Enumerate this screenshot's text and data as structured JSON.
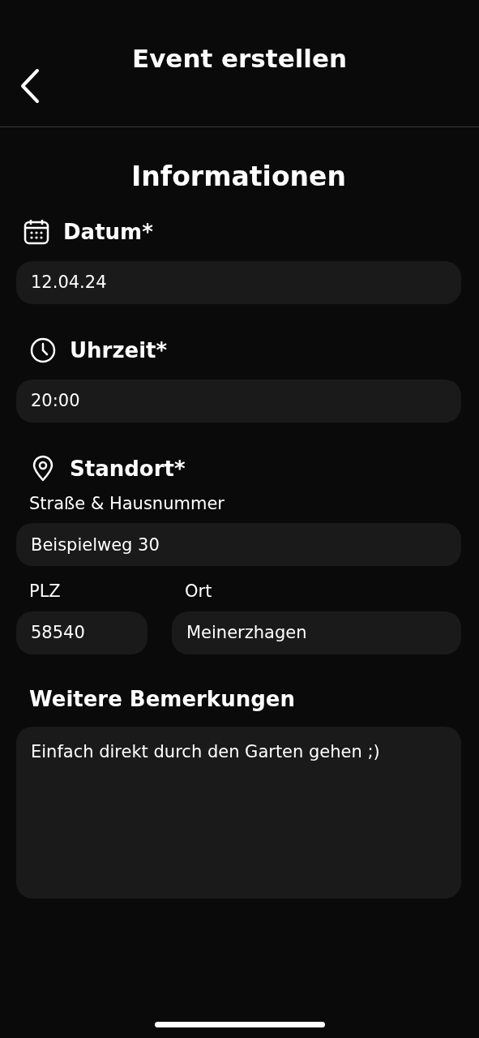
{
  "header": {
    "title": "Event erstellen"
  },
  "section_title": "Informationen",
  "date": {
    "label": "Datum*",
    "value": "12.04.24"
  },
  "time": {
    "label": "Uhrzeit*",
    "value": "20:00"
  },
  "location": {
    "label": "Standort*",
    "street_label": "Straße & Hausnummer",
    "street": "Beispielweg 30",
    "zip_label": "PLZ",
    "zip": "58540",
    "city_label": "Ort",
    "city": "Meinerzhagen"
  },
  "remarks": {
    "label": "Weitere Bemerkungen",
    "value": "Einfach direkt durch den Garten gehen ;)"
  }
}
